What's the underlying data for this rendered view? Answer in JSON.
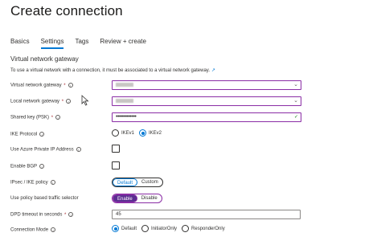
{
  "header": {
    "title": "Create connection",
    "more": "···"
  },
  "tabs": [
    {
      "label": "Basics",
      "active": false
    },
    {
      "label": "Settings",
      "active": true
    },
    {
      "label": "Tags",
      "active": false
    },
    {
      "label": "Review + create",
      "active": false
    }
  ],
  "section": {
    "title": "Virtual network gateway",
    "intro": "To use a virtual network with a connection, it must be associated to a virtual network gateway.",
    "intro_link_icon": "external-link-icon"
  },
  "fields": {
    "vnet_gateway": {
      "label": "Virtual network gateway",
      "required": "*"
    },
    "local_gateway": {
      "label": "Local network gateway",
      "required": "*"
    },
    "shared_key": {
      "label": "Shared key (PSK)",
      "required": "*",
      "value": "•••••••••••••"
    },
    "ike_protocol": {
      "label": "IKE Protocol",
      "options": [
        "IKEv1",
        "IKEv2"
      ],
      "selected": "IKEv2"
    },
    "private_ip": {
      "label": "Use Azure Private IP Address"
    },
    "bgp": {
      "label": "Enable BGP"
    },
    "ipsec_policy": {
      "label": "IPsec / IKE policy",
      "options": [
        "Default",
        "Custom"
      ],
      "selected": "Default"
    },
    "policy_selector": {
      "label": "Use policy based traffic selector",
      "options": [
        "Enable",
        "Disable"
      ],
      "selected": "Enable"
    },
    "dpd_timeout": {
      "label": "DPD timeout in seconds",
      "required": "*",
      "value": "45"
    },
    "connection_mode": {
      "label": "Connection Mode",
      "options": [
        "Default",
        "InitiatorOnly",
        "ResponderOnly"
      ],
      "selected": "Default"
    }
  },
  "colors": {
    "accent": "#0078d4",
    "focus": "#8a2da5",
    "valid": "#107c10"
  }
}
